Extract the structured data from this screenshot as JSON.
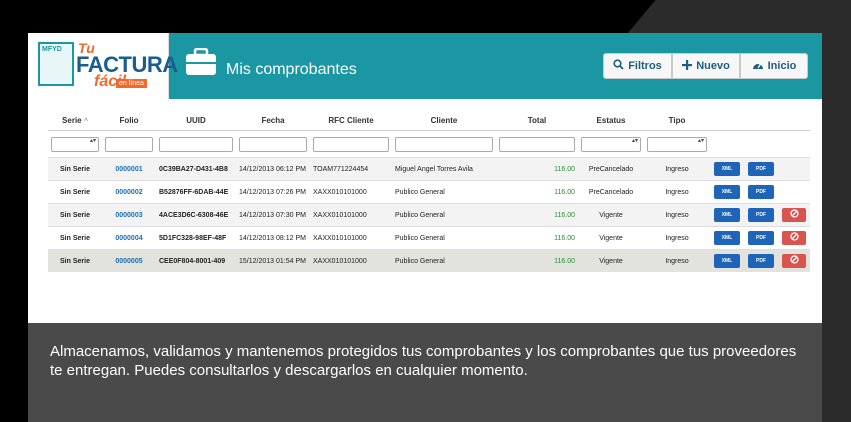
{
  "logo": {
    "badge": "MFYD",
    "tu": "Tu",
    "main": "FACTURA",
    "facil": "fácil",
    "enlinea": "en línea"
  },
  "header": {
    "title": "Mis comprobantes",
    "icon": "briefcase-icon",
    "buttons": [
      {
        "label": "Filtros",
        "icon": "search-icon"
      },
      {
        "label": "Nuevo",
        "icon": "plus-icon"
      },
      {
        "label": "Inicio",
        "icon": "dashboard-icon"
      }
    ]
  },
  "table": {
    "columns": [
      "Serie",
      "Folio",
      "UUID",
      "Fecha",
      "RFC Cliente",
      "Cliente",
      "Total",
      "Estatus",
      "Tipo"
    ],
    "sort_indicator": "^",
    "rows": [
      {
        "serie": "Sin Serie",
        "folio": "0000001",
        "uuid": "0C39BA27-D431-4B8",
        "fecha": "14/12/2013 06:12 PM",
        "rfc": "TOAM771224454",
        "cliente": "Miguel Angel Torres Avila",
        "total": "116.00",
        "estatus": "PreCancelado",
        "tipo": "Ingreso",
        "xml": "XML",
        "pdf": "PDF",
        "cancel": false
      },
      {
        "serie": "Sin Serie",
        "folio": "0000002",
        "uuid": "B52876FF-6DAB-44E",
        "fecha": "14/12/2013 07:26 PM",
        "rfc": "XAXX010101000",
        "cliente": "Publico General",
        "total": "116.00",
        "estatus": "PreCancelado",
        "tipo": "Ingreso",
        "xml": "XML",
        "pdf": "PDF",
        "cancel": false
      },
      {
        "serie": "Sin Serie",
        "folio": "0000003",
        "uuid": "4ACE3D6C-6308-46E",
        "fecha": "14/12/2013 07:30 PM",
        "rfc": "XAXX010101000",
        "cliente": "Publico General",
        "total": "116.00",
        "estatus": "Vigente",
        "tipo": "Ingreso",
        "xml": "XML",
        "pdf": "PDF",
        "cancel": true
      },
      {
        "serie": "Sin Serie",
        "folio": "0000004",
        "uuid": "5D1FC328-98EF-48F",
        "fecha": "14/12/2013 08:12 PM",
        "rfc": "XAXX010101000",
        "cliente": "Publico General",
        "total": "116.00",
        "estatus": "Vigente",
        "tipo": "Ingreso",
        "xml": "XML",
        "pdf": "PDF",
        "cancel": true
      },
      {
        "serie": "Sin Serie",
        "folio": "0000005",
        "uuid": "CEE0F804-8001-409",
        "fecha": "15/12/2013 01:54 PM",
        "rfc": "XAXX010101000",
        "cliente": "Publico General",
        "total": "116.00",
        "estatus": "Vigente",
        "tipo": "Ingreso",
        "xml": "XML",
        "pdf": "PDF",
        "cancel": true
      }
    ]
  },
  "caption": "Almacenamos, validamos y mantenemos protegidos tus comprobantes y los comprobantes que tus proveedores te entregan. Puedes consultarlos y descargarlos en cualquier momento.",
  "colors": {
    "teal": "#1a97a3",
    "orange": "#f16a2b",
    "blue_button": "#1e64b8",
    "red_button": "#d9534f",
    "total_green": "#2a8a36"
  }
}
